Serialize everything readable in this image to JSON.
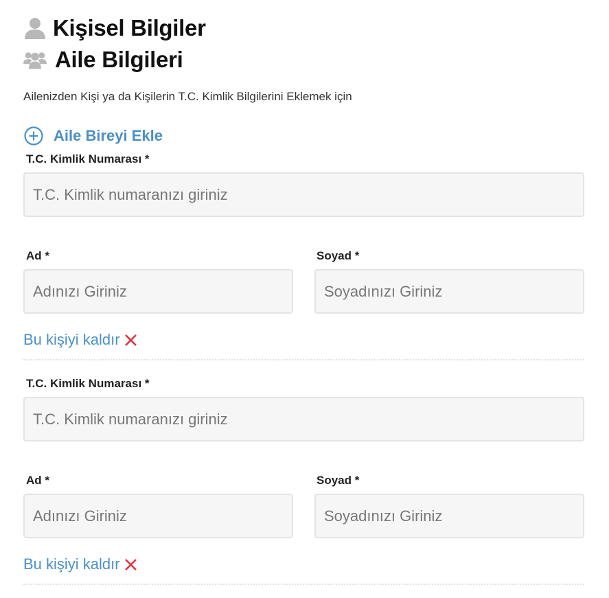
{
  "headings": {
    "personal": "Kişisel Bilgiler",
    "family": "Aile Bilgileri"
  },
  "intro": "Ailenizden Kişi ya da Kişilerin T.C. Kimlik Bilgilerini Eklemek için",
  "add_member": {
    "label": "Aile Bireyi Ekle",
    "icon": "plus-circle-icon"
  },
  "members": [
    {
      "tc_label": "T.C. Kimlik Numarası *",
      "tc_placeholder": "T.C. Kimlik numaranızı giriniz",
      "tc_value": "",
      "name_label": "Ad *",
      "name_placeholder": "Adınızı Giriniz",
      "name_value": "",
      "surname_label": "Soyad *",
      "surname_placeholder": "Soyadınızı Giriniz",
      "surname_value": "",
      "remove_label": "Bu kişiyi kaldır",
      "remove_icon": "close-x-icon"
    },
    {
      "tc_label": "T.C. Kimlik Numarası *",
      "tc_placeholder": "T.C. Kimlik numaranızı giriniz",
      "tc_value": "",
      "name_label": "Ad *",
      "name_placeholder": "Adınızı Giriniz",
      "name_value": "",
      "surname_label": "Soyad *",
      "surname_placeholder": "Soyadınızı Giriniz",
      "surname_value": "",
      "remove_label": "Bu kişiyi kaldır",
      "remove_icon": "close-x-icon"
    }
  ],
  "colors": {
    "link": "#4a90c8",
    "remove_x": "#e0323c",
    "icon_gray": "#b8b8b8",
    "input_bg": "#f6f6f6"
  }
}
